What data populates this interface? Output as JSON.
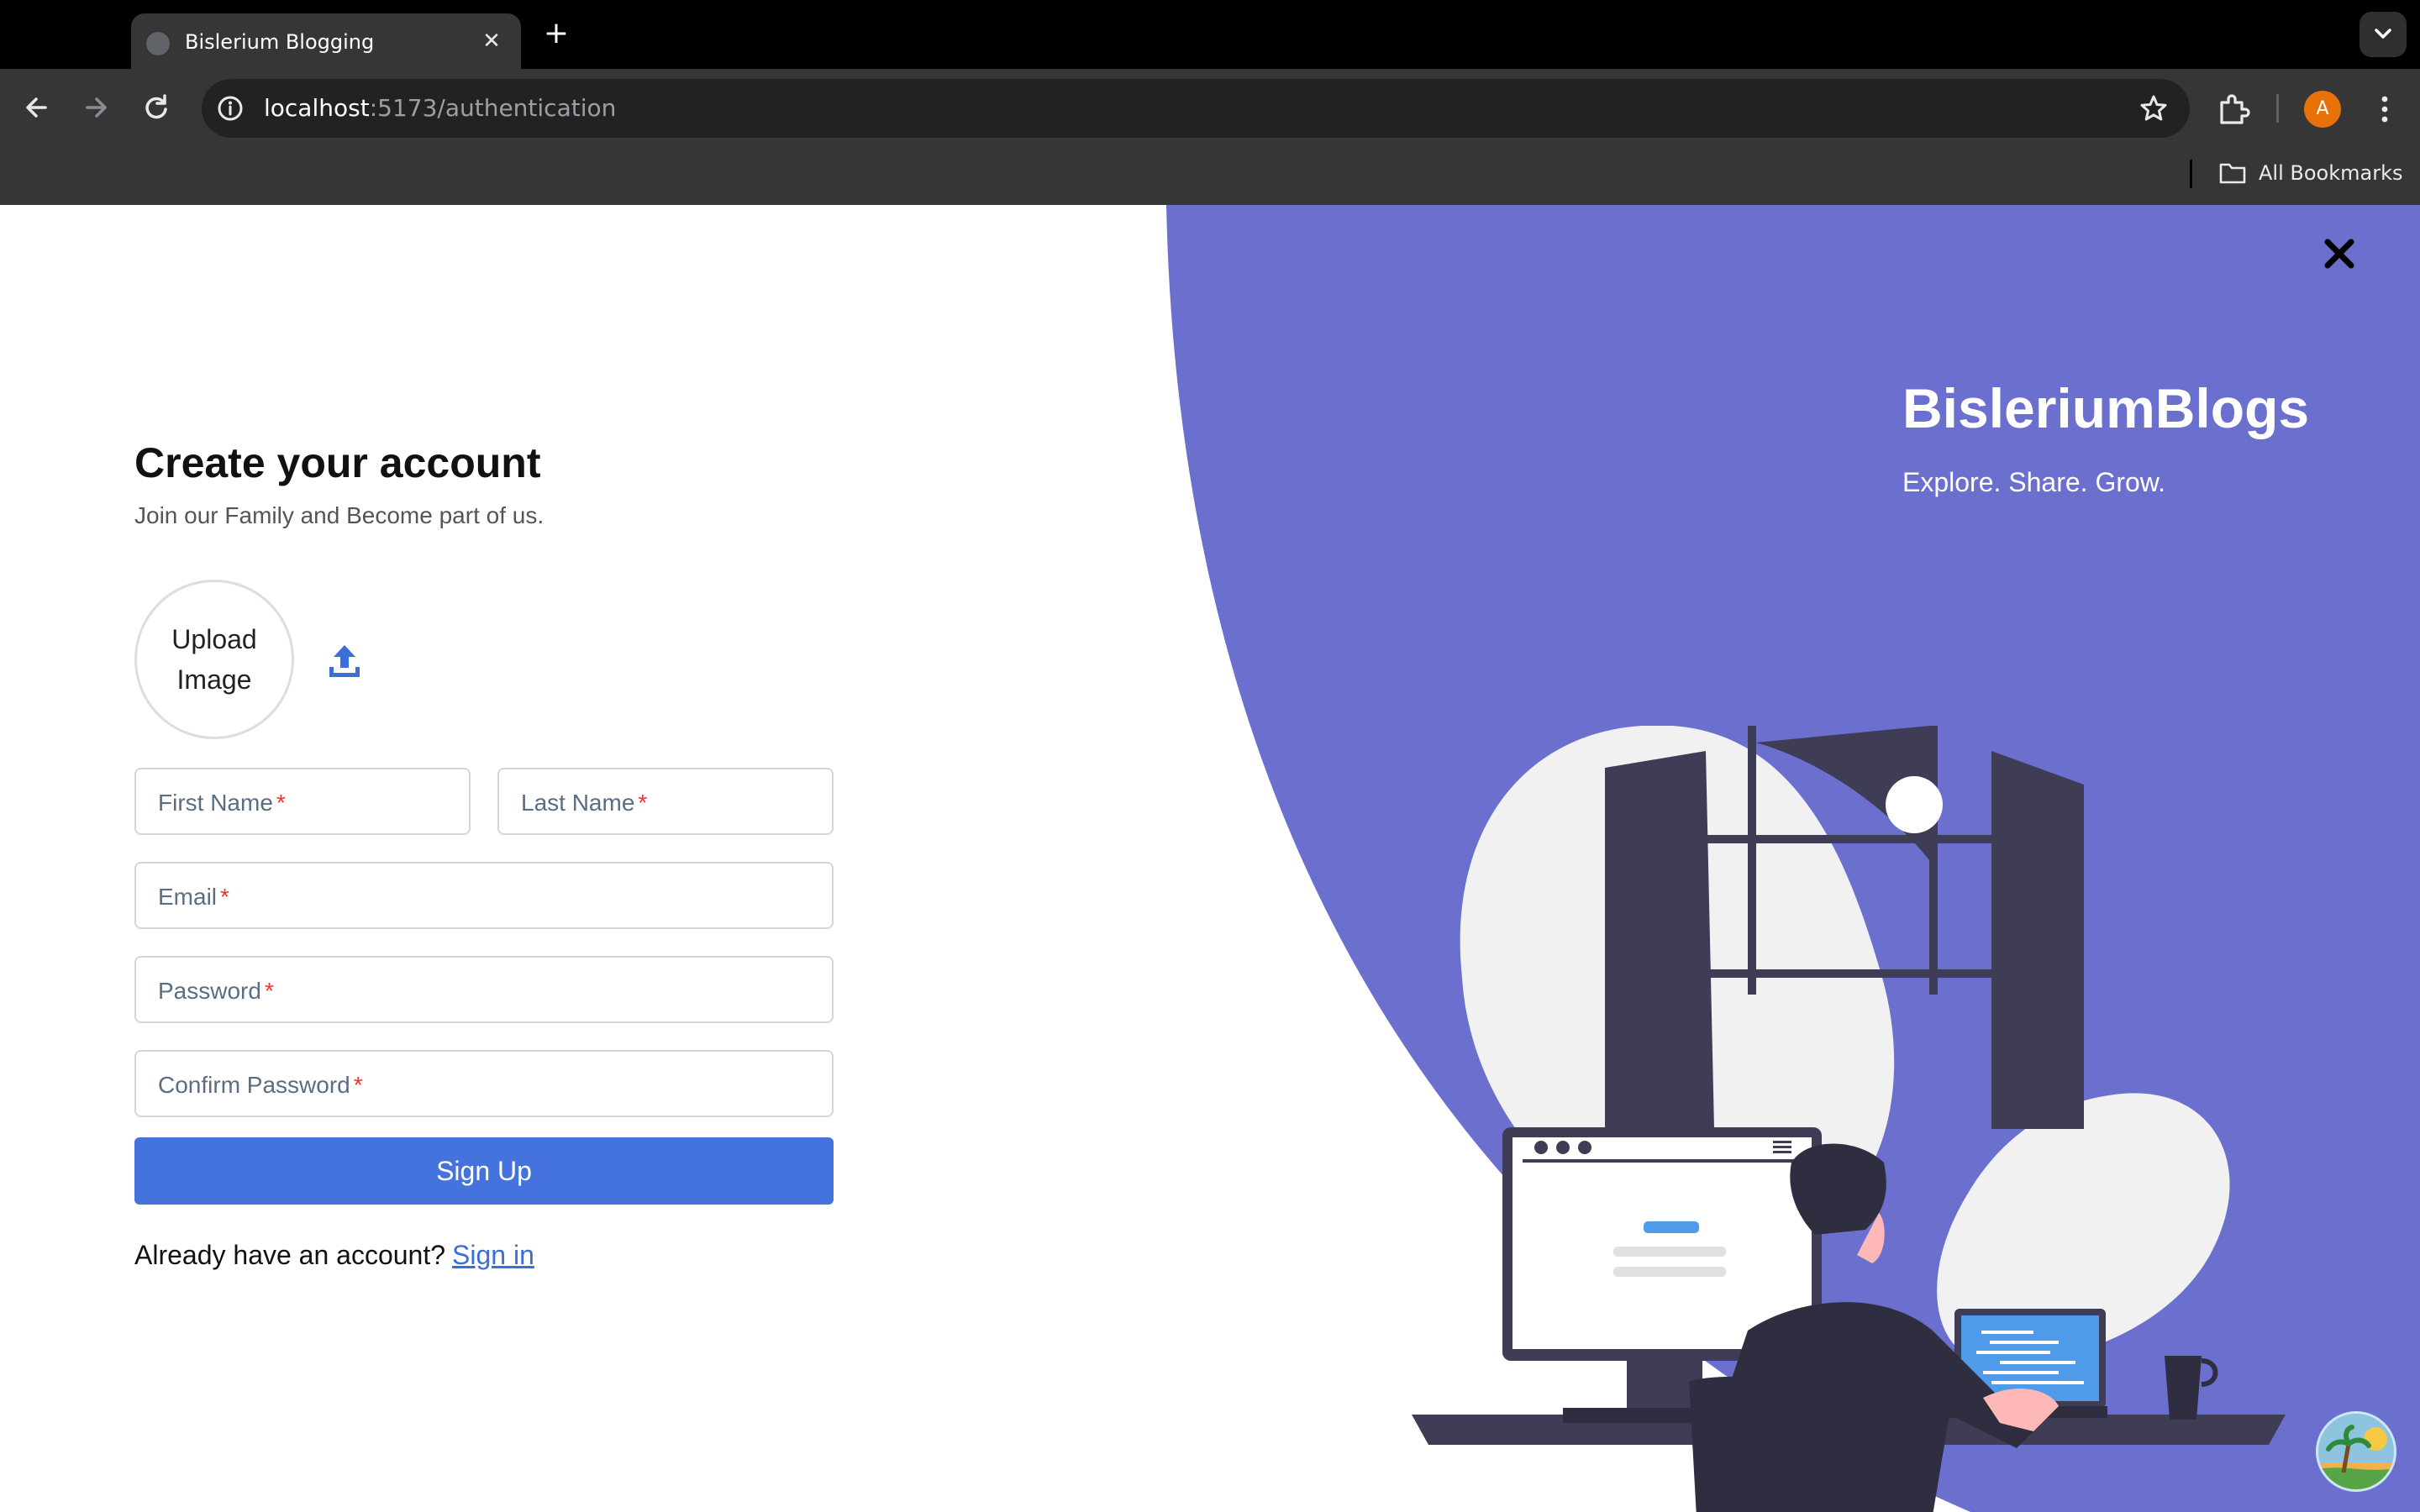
{
  "browser": {
    "tab_title": "Bislerium Blogging",
    "tab_close": "✕",
    "new_tab": "+",
    "url_host": "localhost",
    "url_path": ":5173/authentication",
    "profile_initial": "A",
    "bookmarks_label": "All Bookmarks"
  },
  "form": {
    "heading": "Create your account",
    "subheading": "Join our Family and Become part of us.",
    "upload_label": "Upload Image",
    "fields": {
      "first_name": "First Name",
      "last_name": "Last Name",
      "email": "Email",
      "password": "Password",
      "confirm_password": "Confirm Password",
      "required_mark": "*"
    },
    "signup_label": "Sign Up",
    "signin_prompt": "Already have an account?",
    "signin_link": "Sign in"
  },
  "brand": {
    "title": "BisleriumBlogs",
    "tagline": "Explore. Share. Grow."
  },
  "colors": {
    "accent": "#4473de",
    "panel": "#6b6fce",
    "required": "#e53935"
  }
}
